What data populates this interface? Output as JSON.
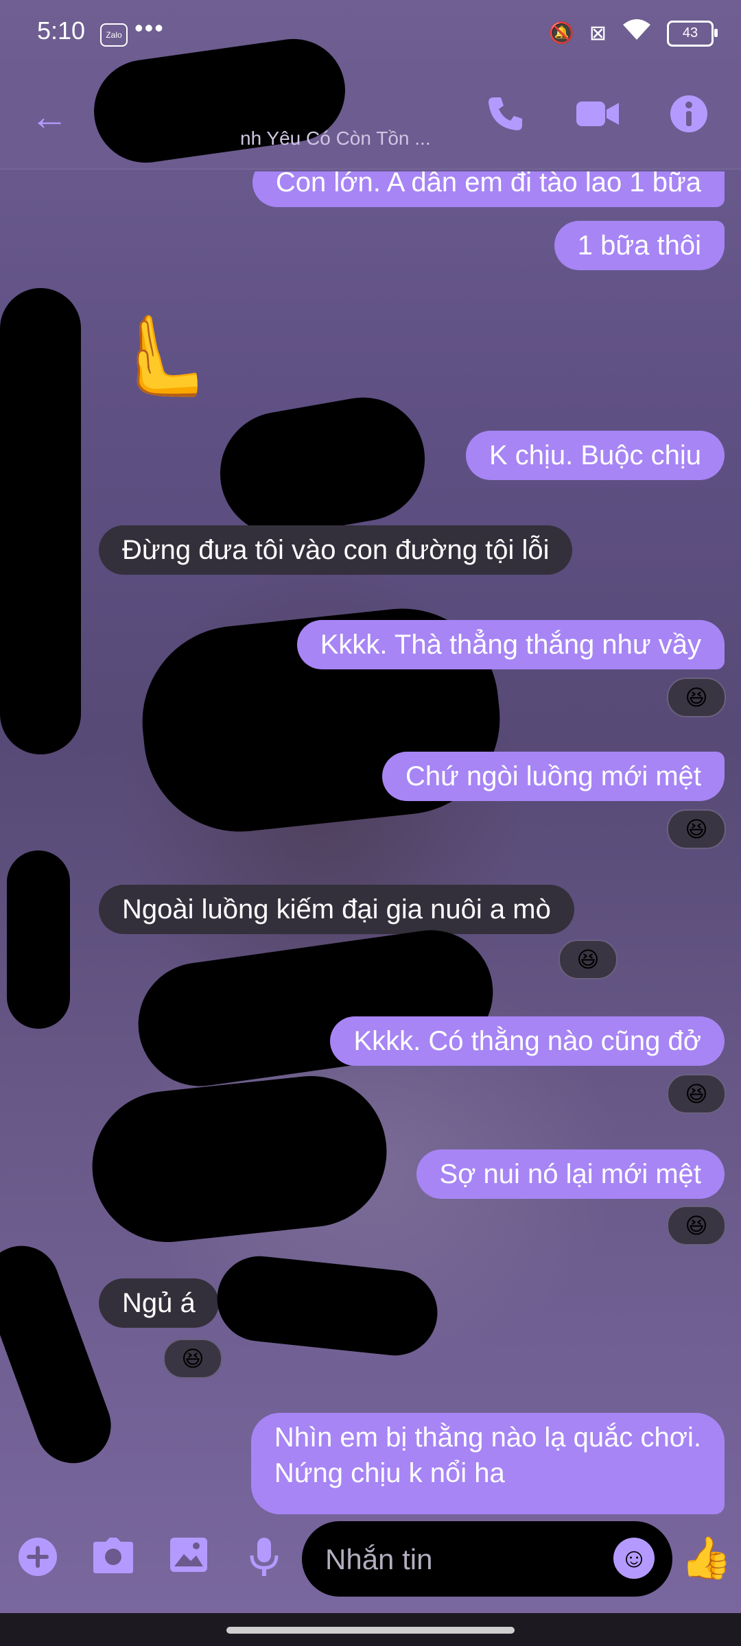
{
  "status_bar": {
    "time": "5:10",
    "app_badge": "Zalo",
    "more": "•••",
    "battery": "43"
  },
  "header": {
    "subtitle": "nh Yêu Có Còn Tồn ...",
    "icons": [
      "back-arrow-icon",
      "phone-icon",
      "video-icon",
      "info-icon"
    ]
  },
  "messages": [
    {
      "from": "me",
      "text": "Con lớn. A dẫn em đi tào lao 1 bữa"
    },
    {
      "from": "me",
      "text": "1 bữa thôi"
    },
    {
      "from": "them",
      "text": "🫷"
    },
    {
      "from": "me",
      "text": "K chịu. Buộc chịu"
    },
    {
      "from": "them",
      "text": "Đừng đưa tôi vào con đường tội lỗi"
    },
    {
      "from": "me",
      "text": "Kkkk. Thà thẳng thắng như vầy",
      "reaction": "😆"
    },
    {
      "from": "me",
      "text": "Chứ ngòi luồng mới mệt",
      "reaction": "😆"
    },
    {
      "from": "them",
      "text": "Ngoài luồng kiếm đại gia nuôi a mò",
      "reaction": "😆"
    },
    {
      "from": "me",
      "text": "Kkkk. Có thằng nào cũng đở",
      "reaction": "😆"
    },
    {
      "from": "me",
      "text": "Sợ nui nó lại mới mệt",
      "reaction": "😆"
    },
    {
      "from": "them",
      "text": "Ngủ á",
      "reaction": "😆"
    },
    {
      "from": "me",
      "text_line1": "Nhìn em bị thằng nào lạ quắc chơi.",
      "text_line2": "Nứng chịu k nổi ha"
    }
  ],
  "composer": {
    "placeholder": "Nhắn tin",
    "icons": [
      "plus-icon",
      "camera-icon",
      "gallery-icon",
      "microphone-icon",
      "emoji-icon",
      "thumbs-up-icon"
    ]
  },
  "colors": {
    "accent": "#b49aff",
    "my_bubble": "#a785f5",
    "their_bubble": "#34303b",
    "header": "#6c5c90"
  }
}
